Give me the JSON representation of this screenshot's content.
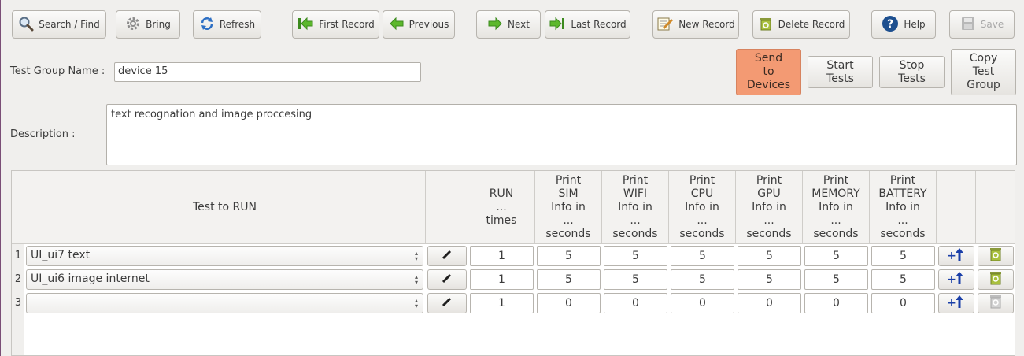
{
  "toolbar": {
    "search": "Search / Find",
    "bring": "Bring",
    "refresh": "Refresh",
    "first_record": "First Record",
    "previous": "Previous",
    "next": "Next",
    "last_record": "Last Record",
    "new_record": "New Record",
    "delete_record": "Delete Record",
    "help": "Help",
    "save": "Save"
  },
  "form": {
    "group_label": "Test Group Name :",
    "group_value": "device 15",
    "description_label": "Description :",
    "description_value": "text recognation and image proccesing"
  },
  "actions": {
    "send": "Send\nto\nDevices",
    "start": "Start\nTests",
    "stop": "Stop\nTests",
    "copy": "Copy\nTest\nGroup"
  },
  "colors": {
    "accent_orange": "#f39a73",
    "help_blue": "#1d4f8f",
    "arrow_blue": "#1a3fa8"
  },
  "table": {
    "headers": {
      "test": "Test to RUN",
      "run": "RUN\n...\ntimes",
      "sim": "Print\nSIM\nInfo in\n...\nseconds",
      "wifi": "Print\nWIFI\nInfo in\n...\nseconds",
      "cpu": "Print\nCPU\nInfo in\n...\nseconds",
      "gpu": "Print\nGPU\nInfo in\n...\nseconds",
      "memory": "Print\nMEMORY\nInfo in\n...\nseconds",
      "battery": "Print\nBATTERY\nInfo in\n...\nseconds"
    },
    "rows": [
      {
        "num": "1",
        "test": "UI_ui7 text",
        "run": "1",
        "sim": "5",
        "wifi": "5",
        "cpu": "5",
        "gpu": "5",
        "memory": "5",
        "battery": "5"
      },
      {
        "num": "2",
        "test": "UI_ui6 image internet",
        "run": "1",
        "sim": "5",
        "wifi": "5",
        "cpu": "5",
        "gpu": "5",
        "memory": "5",
        "battery": "5"
      },
      {
        "num": "3",
        "test": "",
        "run": "1",
        "sim": "0",
        "wifi": "0",
        "cpu": "0",
        "gpu": "0",
        "memory": "0",
        "battery": "0"
      }
    ]
  }
}
